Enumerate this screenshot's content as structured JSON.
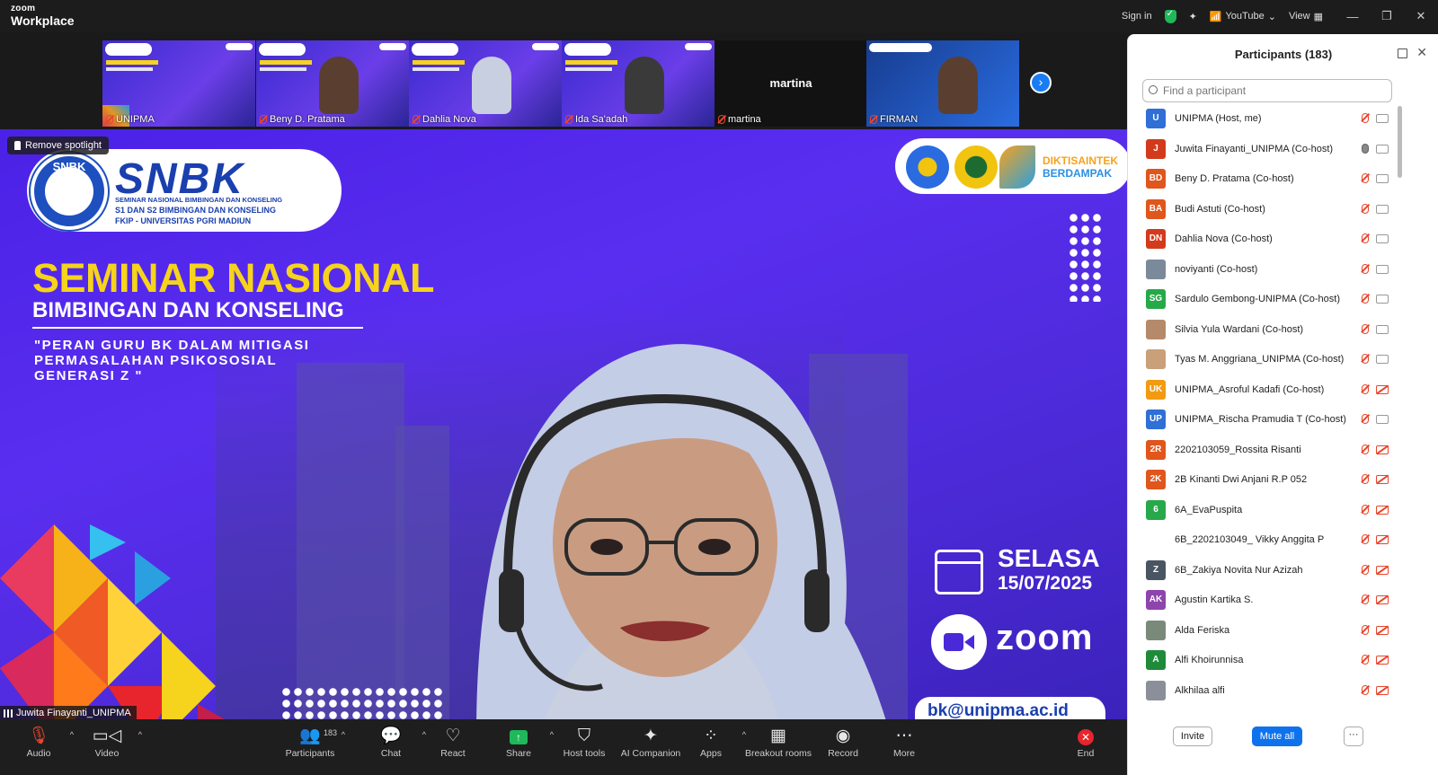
{
  "titlebar": {
    "brand_small": "zoom",
    "brand_large": "Workplace",
    "sign_in": "Sign in",
    "share_source": "YouTube",
    "view": "View"
  },
  "gallery": [
    {
      "name": "UNIPMA",
      "type": "slide"
    },
    {
      "name": "Beny D. Pratama",
      "type": "person-dark"
    },
    {
      "name": "Dahlia Nova",
      "type": "person-hijab"
    },
    {
      "name": "Ida Sa'adah",
      "type": "person-hijab"
    },
    {
      "name": "martina",
      "type": "black",
      "center_label": "martina"
    },
    {
      "name": "FIRMAN",
      "type": "person-blue"
    }
  ],
  "stage": {
    "spotlight_label": "Remove spotlight",
    "speaker_name": "Juwita Finayanti_UNIPMA",
    "slide": {
      "logo_text": "SNBK",
      "title": "SNBK",
      "sub_line1": "SEMINAR NASIONAL BIMBINGAN DAN KONSELING",
      "sub_line2": "S1 DAN S2 BIMBINGAN DAN KONSELING",
      "sub_line3": "FKIP - UNIVERSITAS PGRI MADIUN",
      "heading1": "SEMINAR NASIONAL",
      "heading2": "BIMBINGAN DAN KONSELING",
      "quote_line1": "\"PERAN GURU BK DALAM MITIGASI",
      "quote_line2": "PERMASALAHAN PSIKOSOSIAL",
      "quote_line3": "GENERASI Z \"",
      "partner_line1": "DIKTISAINTEK",
      "partner_line2": "BERDAMPAK",
      "day": "SELASA",
      "date": "15/07/2025",
      "zoom_word": "zoom",
      "email": "bk@unipma.ac.id"
    }
  },
  "toolbar": {
    "audio": "Audio",
    "video": "Video",
    "participants": "Participants",
    "participants_count": "183",
    "chat": "Chat",
    "react": "React",
    "share": "Share",
    "host_tools": "Host tools",
    "ai_companion": "AI Companion",
    "apps": "Apps",
    "breakout_rooms": "Breakout rooms",
    "record": "Record",
    "more": "More",
    "end": "End"
  },
  "panel": {
    "title": "Participants (183)",
    "search_placeholder": "Find a participant",
    "invite": "Invite",
    "mute_all": "Mute all",
    "more": "···",
    "participants": [
      {
        "initials": "U",
        "color": "#2f6fd6",
        "name": "UNIPMA (Host, me)",
        "mic": "muted",
        "cam": "on"
      },
      {
        "initials": "J",
        "color": "#d33a1c",
        "name": "Juwita Finayanti_UNIPMA (Co-host)",
        "mic": "on",
        "cam": "on"
      },
      {
        "initials": "BD",
        "color": "#e0561c",
        "name": "Beny D. Pratama (Co-host)",
        "mic": "muted",
        "cam": "on"
      },
      {
        "initials": "BA",
        "color": "#e0561c",
        "name": "Budi Astuti (Co-host)",
        "mic": "muted",
        "cam": "on"
      },
      {
        "initials": "DN",
        "color": "#d33a1c",
        "name": "Dahlia Nova (Co-host)",
        "mic": "muted",
        "cam": "on"
      },
      {
        "initials": "",
        "color": "#7a8a9a",
        "name": "noviyanti (Co-host)",
        "mic": "muted",
        "cam": "on"
      },
      {
        "initials": "SG",
        "color": "#27a84a",
        "name": "Sardulo Gembong-UNIPMA (Co-host)",
        "mic": "muted",
        "cam": "on"
      },
      {
        "initials": "",
        "color": "#b58a6a",
        "name": "Silvia Yula Wardani (Co-host)",
        "mic": "muted",
        "cam": "on"
      },
      {
        "initials": "",
        "color": "#c9a07a",
        "name": "Tyas M. Anggriana_UNIPMA (Co-host)",
        "mic": "muted",
        "cam": "on"
      },
      {
        "initials": "UK",
        "color": "#f29a12",
        "name": "UNIPMA_Asroful Kadafi (Co-host)",
        "mic": "muted",
        "cam": "off"
      },
      {
        "initials": "UP",
        "color": "#2f6fd6",
        "name": "UNIPMA_Rischa Pramudia T (Co-host)",
        "mic": "muted",
        "cam": "on"
      },
      {
        "initials": "2R",
        "color": "#e0561c",
        "name": "2202103059_Rossita Risanti",
        "mic": "muted",
        "cam": "off"
      },
      {
        "initials": "2K",
        "color": "#e0561c",
        "name": "2B Kinanti Dwi Anjani R.P 052",
        "mic": "muted",
        "cam": "off"
      },
      {
        "initials": "6",
        "color": "#27a84a",
        "name": "6A_EvaPuspita",
        "mic": "muted",
        "cam": "off"
      },
      {
        "initials": "",
        "color": "#ffffff",
        "name": "6B_2202103049_ Vikky Anggita P",
        "mic": "muted",
        "cam": "off"
      },
      {
        "initials": "Z",
        "color": "#4a5563",
        "name": "6B_Zakiya Novita Nur Azizah",
        "mic": "muted",
        "cam": "off"
      },
      {
        "initials": "AK",
        "color": "#8e44ad",
        "name": "Agustin Kartika S.",
        "mic": "muted",
        "cam": "off"
      },
      {
        "initials": "",
        "color": "#7a8a7a",
        "name": "Alda Feriska",
        "mic": "muted",
        "cam": "off"
      },
      {
        "initials": "A",
        "color": "#1f8a3a",
        "name": "Alfi Khoirunnisa",
        "mic": "muted",
        "cam": "off"
      },
      {
        "initials": "",
        "color": "#8a8f99",
        "name": "Alkhilaa alfi",
        "mic": "muted",
        "cam": "off"
      }
    ]
  }
}
